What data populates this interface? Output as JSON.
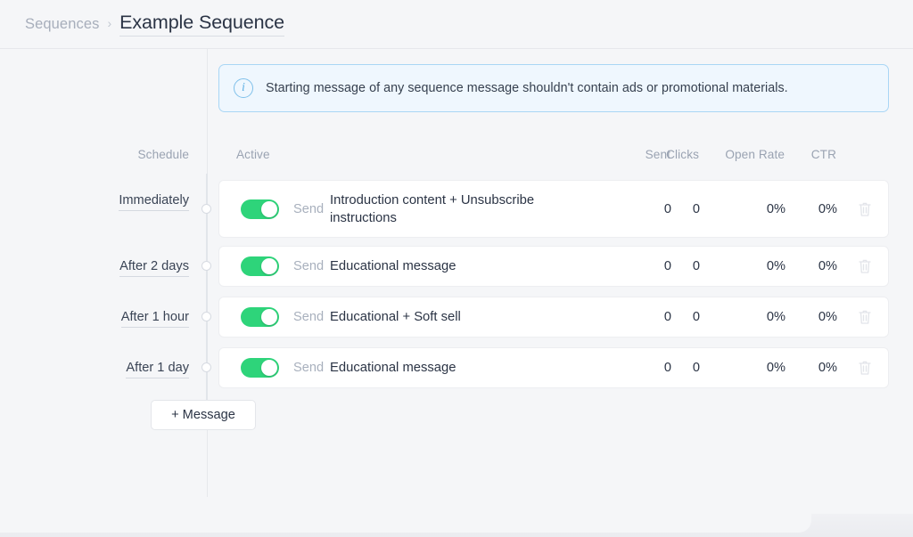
{
  "breadcrumb": {
    "parent": "Sequences",
    "separator": "›",
    "current": "Example Sequence"
  },
  "banner": {
    "icon": "info-icon",
    "text": "Starting message of any sequence message shouldn't contain ads or promotional materials."
  },
  "columns": {
    "schedule": "Schedule",
    "active": "Active",
    "sent": "Sent",
    "clicks": "Clicks",
    "open_rate": "Open Rate",
    "ctr": "CTR"
  },
  "send_label": "Send",
  "rows": [
    {
      "schedule": "Immediately",
      "active": true,
      "send": "Send",
      "title": "Introduction content + Unsubscribe instructions",
      "sent": "0",
      "clicks": "0",
      "open_rate": "0%",
      "ctr": "0%"
    },
    {
      "schedule": "After 2 days",
      "active": true,
      "send": "Send",
      "title": "Educational message",
      "sent": "0",
      "clicks": "0",
      "open_rate": "0%",
      "ctr": "0%"
    },
    {
      "schedule": "After 1 hour",
      "active": true,
      "send": "Send",
      "title": "Educational + Soft sell",
      "sent": "0",
      "clicks": "0",
      "open_rate": "0%",
      "ctr": "0%"
    },
    {
      "schedule": "After 1 day",
      "active": true,
      "send": "Send",
      "title": "Educational message",
      "sent": "0",
      "clicks": "0",
      "open_rate": "0%",
      "ctr": "0%"
    }
  ],
  "add_message_button": "+ Message",
  "colors": {
    "toggle_on": "#2ed47a",
    "banner_border": "#a9d6f5",
    "banner_bg": "#eff7fe",
    "page_bg": "#f5f6f8",
    "text_dark": "#2b3445",
    "text_muted": "#9aa3b2"
  }
}
